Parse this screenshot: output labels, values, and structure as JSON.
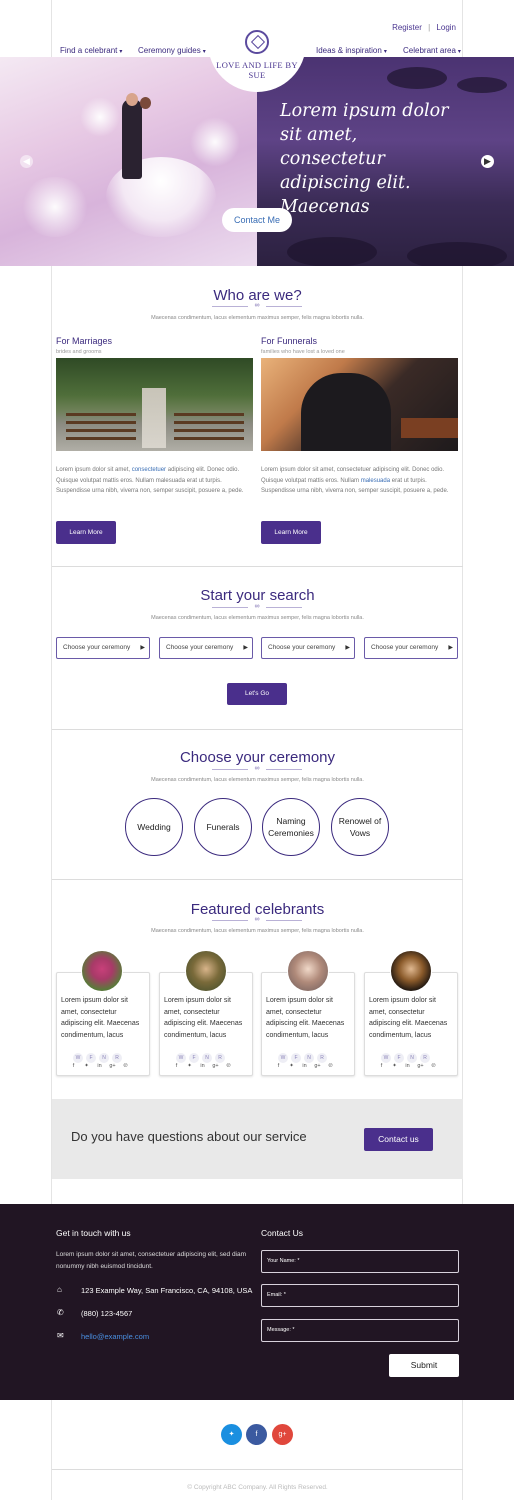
{
  "header": {
    "register": "Register",
    "sep": "|",
    "login": "Login",
    "nav": [
      {
        "label": "Find a celebrant"
      },
      {
        "label": "Ceremony guides"
      },
      {
        "label": "Ideas & inspiration"
      },
      {
        "label": "Celebrant area"
      }
    ],
    "caret": "▾",
    "logo_text": "LOVE AND LIFE BY SUE"
  },
  "hero": {
    "quote": "Lorem ipsum dolor sit amet, consectetur adipiscing elit. Maecenas",
    "button": "Contact Me",
    "prev_icon": "chevron-left-icon",
    "next_icon": "chevron-right-icon"
  },
  "who": {
    "title": "Who are we?",
    "subtitle": "Maecenas condimentum, lacus elementum maximus semper, felis magna lobortis nulla.",
    "cols": [
      {
        "title": "For Marriages",
        "sub": "brides and grooms",
        "text_a": "Lorem ipsum dolor sit amet, ",
        "text_hl": "consectetuer",
        "text_b": " adipiscing elit. Donec odio. Quisque volutpat mattis eros. Nullam malesuada erat ut turpis. Suspendisse urna nibh, viverra non, semper suscipit, posuere a, pede.",
        "button": "Learn More"
      },
      {
        "title": "For Funnerals",
        "sub": "families who have lost a loved one",
        "text_a": "Lorem ipsum dolor sit amet, consectetuer adipiscing elit. Donec odio. Quisque volutpat mattis eros. Nullam ",
        "text_hl": "malesuada",
        "text_b": " erat ut turpis. Suspendisse urna nibh, viverra non, semper suscipit, posuere a, pede.",
        "button": "Learn More"
      }
    ]
  },
  "search": {
    "title": "Start your search",
    "subtitle": "Maecenas condimentum, lacus elementum maximus semper, felis magna lobortis nulla.",
    "selects": [
      "Choose your ceremony",
      "Choose your ceremony",
      "Choose your ceremony",
      "Choose your ceremony"
    ],
    "button": "Let's Go"
  },
  "ceremony": {
    "title": "Choose your ceremony",
    "subtitle": "Maecenas condimentum, lacus elementum maximus semper, felis magna lobortis nulla.",
    "items": [
      "Wedding",
      "Funerals",
      "Naming Ceremonies",
      "Renowel of Vows"
    ]
  },
  "celebrants": {
    "title": "Featured celebrants",
    "subtitle": "Maecenas condimentum, lacus elementum maximus semper, felis magna lobortis nulla.",
    "card_text": "Lorem ipsum dolor sit amet, consectetur adipiscing elit. Maecenas condimentum, lacus",
    "badges": [
      "W",
      "F",
      "N",
      "R"
    ],
    "social_icons": [
      "facebook-icon",
      "twitter-icon",
      "linkedin-icon",
      "google-plus-icon",
      "pinterest-icon"
    ]
  },
  "question": {
    "text": "Do you have questions about our service",
    "button": "Contact us"
  },
  "footer": {
    "touch_title": "Get in touch with us",
    "touch_text": "Lorem ipsum dolor sit amet, consectetuer adipiscing elit, sed diam nonummy nibh euismod tincidunt.",
    "address": "123 Example Way, San Francisco, CA, 94108, USA",
    "phone": "(880) 123-4567",
    "email": "hello@example.com",
    "contact_title": "Contact Us",
    "name_label": "Your Name: *",
    "email_label": "Email: *",
    "message_label": "Message: *",
    "submit": "Submit",
    "copyright": "© Copyright ABC Company. All Rights Reserved."
  },
  "colors": {
    "brand": "#4a2f8c",
    "footer_bg": "#211523",
    "twitter": "#1a8fe0",
    "facebook": "#3b5aa0",
    "google": "#e0473c"
  }
}
